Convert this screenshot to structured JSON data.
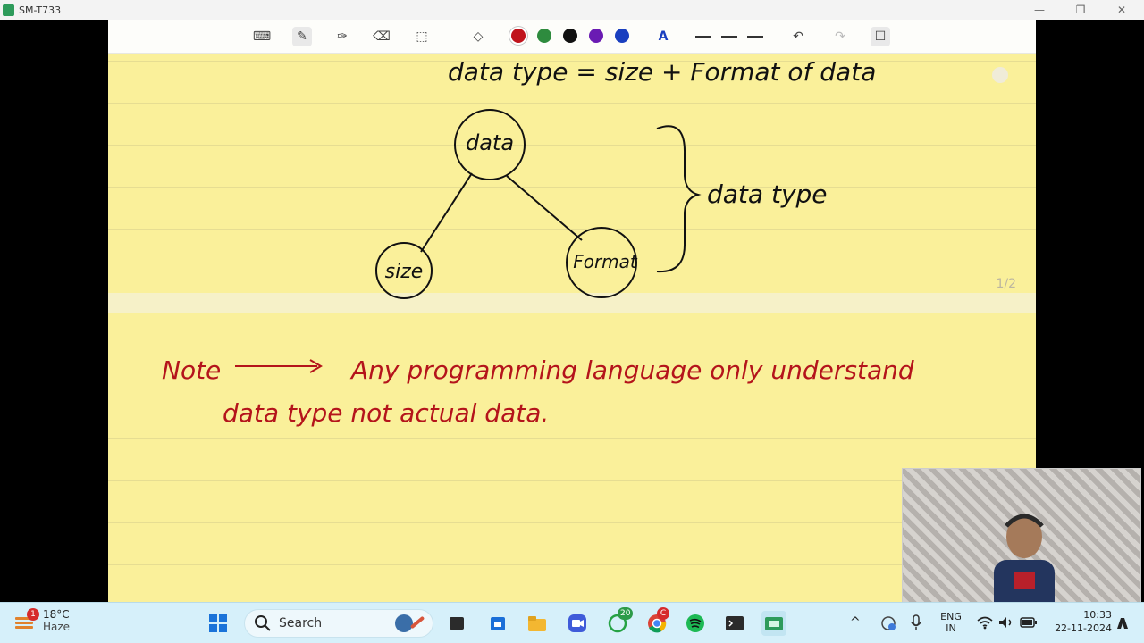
{
  "window": {
    "title": "SM-T733",
    "minimize_glyph": "—",
    "maximize_glyph": "❐",
    "close_glyph": "✕"
  },
  "toolbar": {
    "tools": [
      {
        "name": "keyboard-icon",
        "glyph": "⌨"
      },
      {
        "name": "pen-icon",
        "glyph": "✎"
      },
      {
        "name": "highlighter-icon",
        "glyph": "✑"
      },
      {
        "name": "eraser-icon",
        "glyph": "⌫"
      },
      {
        "name": "lasso-select-icon",
        "glyph": "⬚"
      },
      {
        "name": "shapes-icon",
        "glyph": "◇"
      }
    ],
    "colors": [
      "#c0141c",
      "#2e8b3e",
      "#111111",
      "#6a1bb3",
      "#1a3fbf"
    ],
    "text_tool_glyph": "A",
    "undo_glyph": "↶",
    "redo_glyph": "↷",
    "lock_glyph": "☐"
  },
  "notes": {
    "equation": "data type  =  size + Format of data",
    "node_top": "data",
    "node_left": "size",
    "node_right": "Format",
    "brace_label": "data type",
    "page_number": "1/2",
    "note_line1_prefix": "Note",
    "note_line1_text": "Any programming language only understand",
    "note_line2_text": "data type not actual data."
  },
  "taskbar": {
    "weather_temp": "18°C",
    "weather_desc": "Haze",
    "weather_badge": "1",
    "search_label": "Search",
    "whatsapp_badge": "20",
    "chrome_badge": "C",
    "lang_top": "ENG",
    "lang_bottom": "IN",
    "time": "10:33",
    "date": "22-11-2024"
  }
}
